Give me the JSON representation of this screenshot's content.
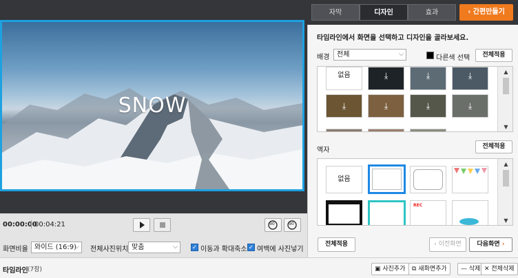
{
  "preview": {
    "overlay_text": "SNOW",
    "time_current": "00:00:00",
    "time_total": "00:04:21",
    "rotate_left_label": "90",
    "rotate_right_label": "90",
    "aspect_label": "화면비율",
    "aspect_value": "와이드 (16:9)",
    "photo_pos_label": "전체사진위치",
    "photo_pos_value": "맞춤",
    "move_zoom_label": "이동과 확대축소",
    "margin_photo_label": "여백에 사진넣기",
    "accent_color": "#1da1e0"
  },
  "tabs": [
    "자막",
    "디자인",
    "효과"
  ],
  "quick_make_label": "간편만들기",
  "design": {
    "instruction": "타임라인에서 화면을 선택하고 디자인을 골라보세요.",
    "bg_label": "배경",
    "bg_select": "전체",
    "other_color_label": "다른색 선택",
    "apply_all": "전체적용",
    "none_label": "없음",
    "frame_label": "액자",
    "frame_apply_all": "전체적용",
    "frame_none": "없음",
    "rec_label": "REC",
    "bottom_apply_all": "전체적용",
    "prev_screen": "이전화면",
    "next_screen": "다음화면"
  },
  "timeline": {
    "title": "타임라인",
    "count": "(7장)",
    "add_photo": "사진추가",
    "add_new_screen": "새화면추가",
    "delete": "삭제",
    "delete_all": "전체삭제"
  }
}
